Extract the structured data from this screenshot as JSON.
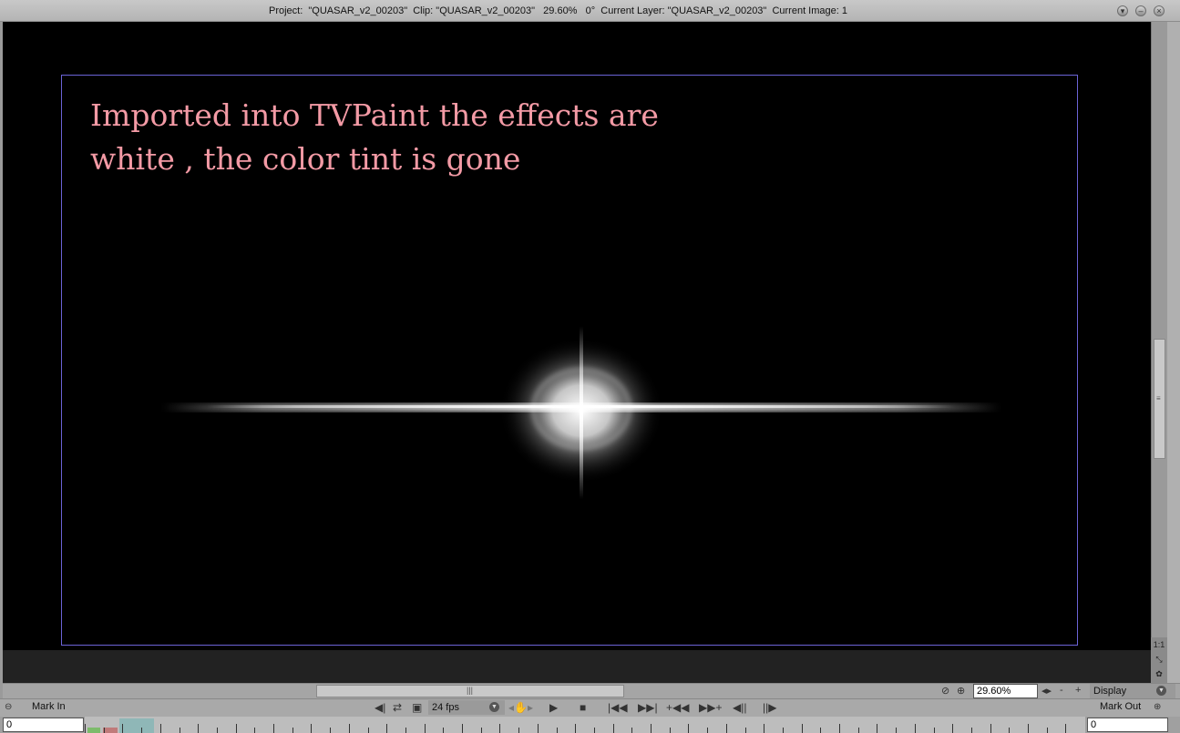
{
  "window": {
    "title": "Project:  \"QUASAR_v2_00203\"  Clip: \"QUASAR_v2_00203\"   29.60%   0°  Current Layer: \"QUASAR_v2_00203\"  Current Image: 1",
    "buttons": [
      "minimize-icon",
      "restore-icon",
      "close-icon"
    ]
  },
  "canvas": {
    "annotation_line1": "Imported into TVPaint the effects are",
    "annotation_line2": "white , the color tint is gone",
    "annotation_color": "#f39aa5",
    "frame_color": "#6b63d6"
  },
  "view_bar": {
    "zoom_value": "29.60%",
    "display_label": "Display"
  },
  "playback": {
    "mark_in_label": "Mark In",
    "mark_out_label": "Mark Out",
    "fps_value": "24 fps"
  },
  "timeline": {
    "mark_in_value": "0",
    "mark_out_value": "0"
  }
}
